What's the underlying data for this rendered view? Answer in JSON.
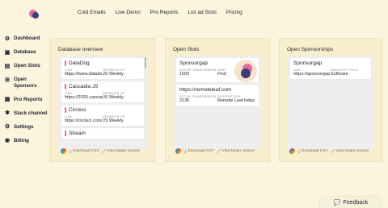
{
  "topnav": [
    "Cold Emails",
    "Live Demo",
    "Pro Reports",
    "List ad Slots",
    "Pricing"
  ],
  "sidebar": [
    {
      "label": "Dashboard",
      "icon": "gear-icon"
    },
    {
      "label": "Database",
      "icon": "inbox-icon"
    },
    {
      "label": "Open Slots",
      "icon": "window-icon"
    },
    {
      "label": "Open Sponsors",
      "icon": "grid-icon"
    },
    {
      "label": "Pro Reports",
      "icon": "document-icon"
    },
    {
      "label": "Slack channel",
      "icon": "chat-icon"
    },
    {
      "label": "Settings",
      "icon": "gear-icon"
    },
    {
      "label": "Billing",
      "icon": "user-icon"
    }
  ],
  "panels": {
    "db": {
      "title": "Database overview",
      "cards": [
        {
          "name": "DataDog",
          "link_label": "LINK",
          "link": "https://www.datadog...",
          "sponsor_label": "SPONSOR OF",
          "sponsor": "JS Weekly"
        },
        {
          "name": "Cascadia JS",
          "link_label": "LINK",
          "link": "https://2020.cascadi...",
          "sponsor_label": "SPONSOR OF",
          "sponsor": "JS Weekly"
        },
        {
          "name": "Circleci",
          "link_label": "LINK",
          "link": "https://circleci.com/b...",
          "sponsor_label": "SPONSOR OF",
          "sponsor": "JS Weekly"
        },
        {
          "name": "Stream"
        }
      ]
    },
    "slots": {
      "title": "Open Slots",
      "cards": [
        {
          "name": "Sponsorgap",
          "a_label": "ACTIVE SUBSCRIBERS",
          "a": "1000",
          "b_label": "DESC",
          "b": "Find"
        },
        {
          "name": "https://remoteleaf.com",
          "a_label": "ACTIVE SUBSCRIBERS",
          "a": "2135",
          "b_label": "DESCRIPTION",
          "b": "Remote Leaf helps"
        }
      ]
    },
    "sponsorships": {
      "title": "Open Sponsorships",
      "cards": [
        {
          "name": "Sponsorgap",
          "a_label": "LINK",
          "a": "https://sponsorgap.c...",
          "b_label": "INDUSTRY FIELD",
          "b": "Software"
        }
      ]
    }
  },
  "footer": {
    "download": "Download CSV",
    "expand": "View larger version"
  },
  "feedback": "Feedback",
  "colors": {
    "background": "#fbf5de",
    "accent_pink": "#e46a9c",
    "accent_navy": "#3a3f7a"
  }
}
